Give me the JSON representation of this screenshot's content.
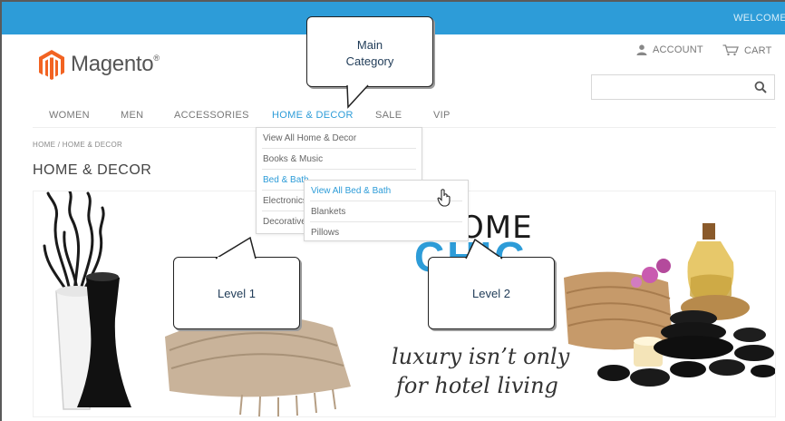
{
  "header": {
    "welcome": "WELCOME",
    "logo_text": "Magento",
    "logo_reg": "®",
    "account_label": "ACCOUNT",
    "cart_label": "CART",
    "search_placeholder": ""
  },
  "nav": {
    "items": [
      {
        "label": "WOMEN"
      },
      {
        "label": "MEN"
      },
      {
        "label": "ACCESSORIES"
      },
      {
        "label": "HOME & DECOR"
      },
      {
        "label": "SALE"
      },
      {
        "label": "VIP"
      }
    ],
    "active_index": 3
  },
  "breadcrumb": {
    "text": "HOME / HOME & DECOR"
  },
  "page_title": "HOME & DECOR",
  "dropdown_level1": {
    "items": [
      {
        "label": "View All Home & Decor"
      },
      {
        "label": "Books & Music"
      },
      {
        "label": "Bed & Bath"
      },
      {
        "label": "Electronics"
      },
      {
        "label": "Decorative"
      }
    ]
  },
  "dropdown_level2": {
    "items": [
      {
        "label": "View All Bed & Bath"
      },
      {
        "label": "Blankets"
      },
      {
        "label": "Pillows"
      }
    ]
  },
  "hero": {
    "title": "OME",
    "subtitle": "CHIC",
    "dots": "•••",
    "tagline_line1": "luxury isn’t only",
    "tagline_line2": "for hotel living"
  },
  "callouts": {
    "main_line1": "Main",
    "main_line2": "Category",
    "level1": "Level 1",
    "level2": "Level 2"
  },
  "colors": {
    "accent": "#2d9cd8",
    "logo_orange": "#f26322",
    "text_gray": "#777777"
  },
  "icons": {
    "account": "person-icon",
    "cart": "cart-icon",
    "search": "search-icon",
    "cursor": "hand-pointer-icon"
  }
}
